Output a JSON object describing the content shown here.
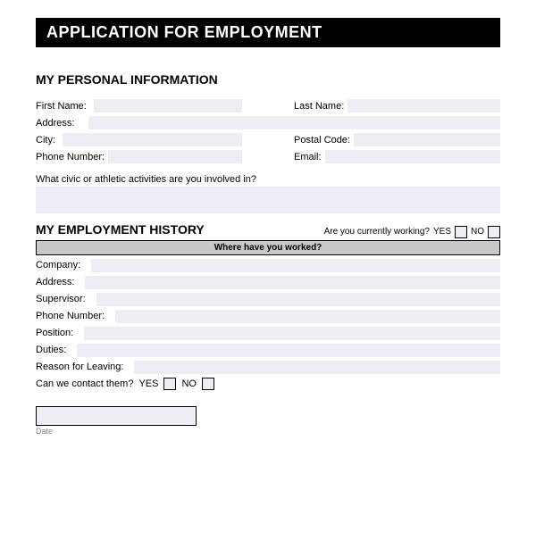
{
  "title": "APPLICATION FOR EMPLOYMENT",
  "personal": {
    "section_title": "MY PERSONAL INFORMATION",
    "first_name_label": "First Name:",
    "last_name_label": "Last Name:",
    "address_label": "Address:",
    "city_label": "City:",
    "postal_code_label": "Postal Code:",
    "phone_label": "Phone Number:",
    "email_label": "Email:",
    "activities_label": "What civic or athletic activities are you involved in?"
  },
  "employment": {
    "section_title": "MY EMPLOYMENT HISTORY",
    "currently_working_label": "Are you currently working?",
    "yes_label": "YES",
    "no_label": "NO",
    "where_worked_label": "Where have you worked?",
    "company_label": "Company:",
    "address_label": "Address:",
    "supervisor_label": "Supervisor:",
    "phone_label": "Phone Number:",
    "position_label": "Position:",
    "duties_label": "Duties:",
    "reason_label": "Reason for Leaving:",
    "contact_label": "Can we contact them?",
    "contact_yes": "YES",
    "contact_no": "NO"
  },
  "footer": {
    "date_label": "Date"
  }
}
